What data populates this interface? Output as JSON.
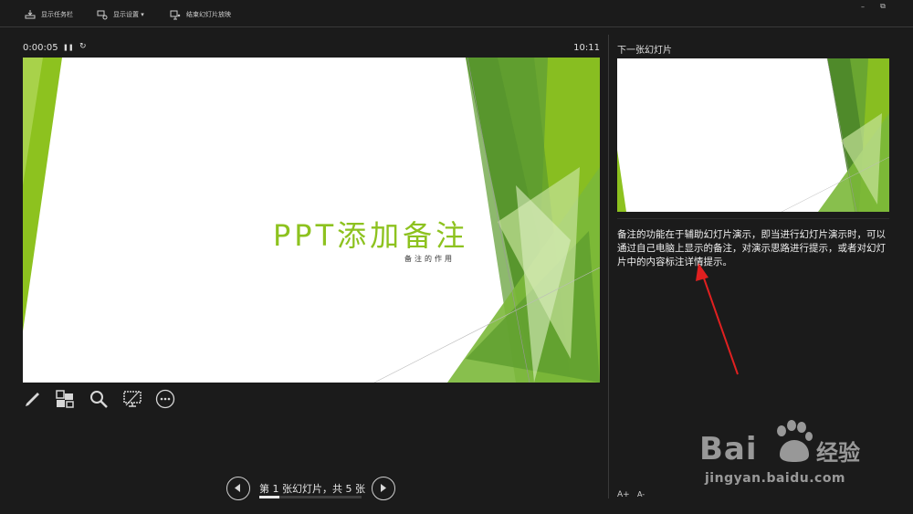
{
  "toolbar": {
    "show_taskbar": "显示任务栏",
    "display_settings": "显示设置 ▾",
    "end_show": "结束幻灯片放映"
  },
  "window": {
    "minimize": "–",
    "restore": "⧉"
  },
  "timer": {
    "elapsed": "0:00:05",
    "pause": "❚❚",
    "reset": "↻",
    "clock": "10:11"
  },
  "slide": {
    "title": "PPT添加备注",
    "subtitle": "备注的作用"
  },
  "tools": [
    "pen-icon",
    "view-all-slides-icon",
    "zoom-icon",
    "black-screen-icon",
    "more-options-icon"
  ],
  "right_panel": {
    "next_label": "下一张幻灯片",
    "notes": "备注的功能在于辅助幻灯片演示，即当进行幻灯片演示时，可以通过自己电脑上显示的备注，对演示思路进行提示，或者对幻灯片中的内容标注详情提示。",
    "font_up": "A+",
    "font_down": "A-"
  },
  "navigation": {
    "counter": "第 1 张幻灯片，共 5 张",
    "current": 1,
    "total": 5,
    "progress": 0.2
  },
  "watermark": {
    "brand": "Bai",
    "brand_cn": "经验",
    "url": "jingyan.baidu.com"
  },
  "colors": {
    "accent_green": "#8dc21f",
    "background": "#1b1b1b",
    "annotation_red": "#e02020"
  }
}
